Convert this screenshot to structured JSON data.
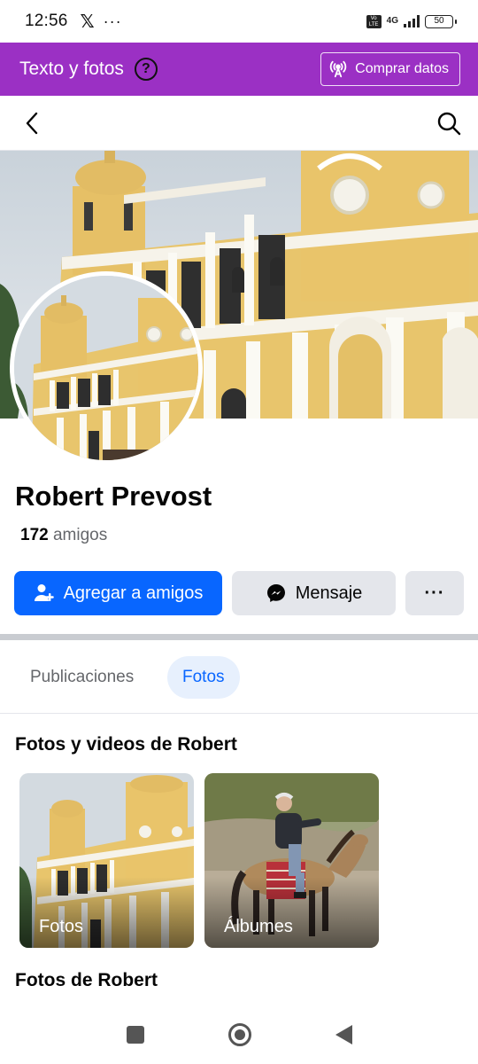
{
  "status_bar": {
    "time": "12:56",
    "x_logo": "𝕏",
    "more": "···",
    "volte": "Vo\nLTE",
    "network": "4G",
    "battery": "50"
  },
  "promo_bar": {
    "title": "Texto y fotos",
    "help_symbol": "?",
    "button_label": "Comprar datos",
    "background": "#9b30c4"
  },
  "top_nav": {
    "back_icon": "chevron-left-icon",
    "search_icon": "search-icon"
  },
  "profile": {
    "name": "Robert Prevost",
    "friends_count": "172",
    "friends_label": "amigos"
  },
  "actions": {
    "add_friend_label": "Agregar a amigos",
    "message_label": "Mensaje",
    "more_label": "···",
    "primary_color": "#0866ff"
  },
  "tabs": [
    {
      "label": "Publicaciones",
      "active": false
    },
    {
      "label": "Fotos",
      "active": true
    }
  ],
  "photos_section": {
    "title": "Fotos y videos de Robert",
    "cards": [
      {
        "label": "Fotos"
      },
      {
        "label": "Álbumes"
      }
    ]
  },
  "robert_photos_section": {
    "title": "Fotos de Robert"
  }
}
